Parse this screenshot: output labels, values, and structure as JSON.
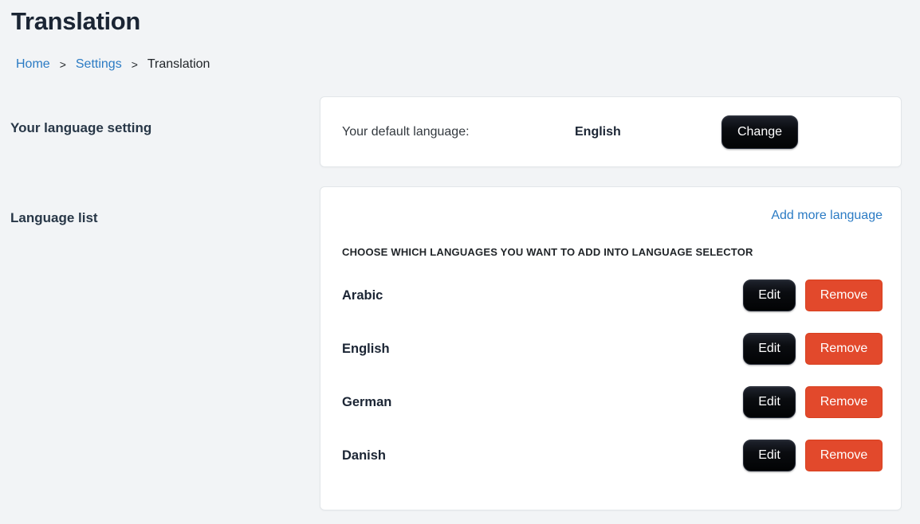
{
  "page": {
    "title": "Translation"
  },
  "breadcrumb": {
    "separator": ">",
    "items": [
      {
        "label": "Home"
      },
      {
        "label": "Settings"
      },
      {
        "label": "Translation"
      }
    ]
  },
  "sections": {
    "language_setting": {
      "label": "Your language setting",
      "default_language_label": "Your default language:",
      "default_language_value": "English",
      "change_button_label": "Change"
    },
    "language_list": {
      "label": "Language list",
      "add_link_label": "Add more language",
      "heading": "CHOOSE WHICH LANGUAGES YOU WANT TO ADD INTO LANGUAGE SELECTOR",
      "edit_label": "Edit",
      "remove_label": "Remove",
      "languages": [
        {
          "name": "Arabic"
        },
        {
          "name": "English"
        },
        {
          "name": "German"
        },
        {
          "name": "Danish"
        }
      ]
    }
  },
  "colors": {
    "link_blue": "#2b7bc4",
    "remove_red": "#e2492c",
    "dark_button": "#0a0c10",
    "page_background": "#f2f4f6"
  }
}
